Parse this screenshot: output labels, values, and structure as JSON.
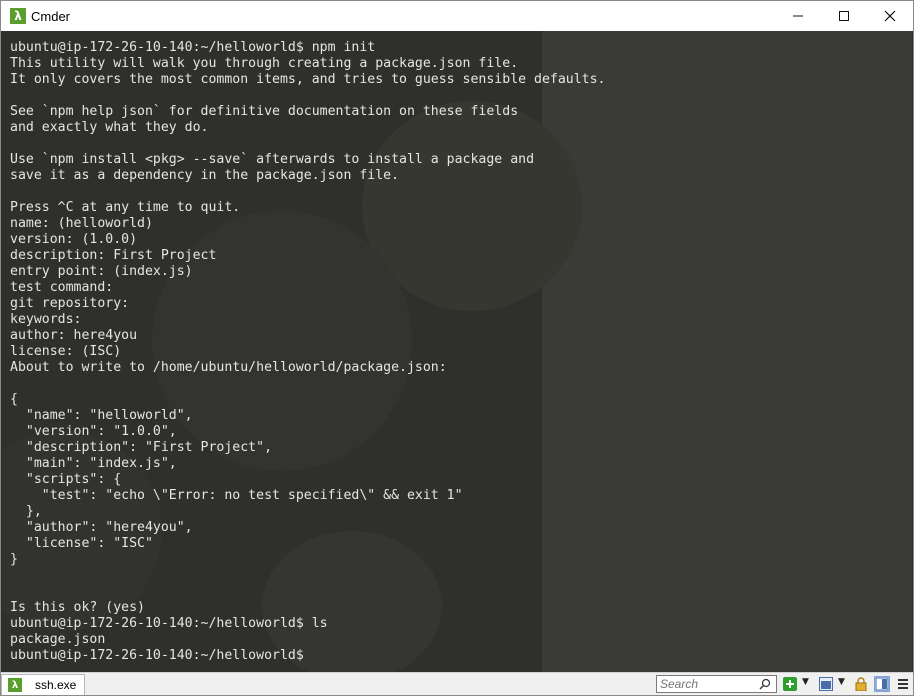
{
  "window": {
    "title": "Cmder",
    "app_icon_glyph": "λ",
    "controls": {
      "minimize": "—",
      "maximize": "☐",
      "close": "✕"
    }
  },
  "terminal": {
    "lines": [
      "ubuntu@ip-172-26-10-140:~/helloworld$ npm init",
      "This utility will walk you through creating a package.json file.",
      "It only covers the most common items, and tries to guess sensible defaults.",
      "",
      "See `npm help json` for definitive documentation on these fields",
      "and exactly what they do.",
      "",
      "Use `npm install <pkg> --save` afterwards to install a package and",
      "save it as a dependency in the package.json file.",
      "",
      "Press ^C at any time to quit.",
      "name: (helloworld)",
      "version: (1.0.0)",
      "description: First Project",
      "entry point: (index.js)",
      "test command:",
      "git repository:",
      "keywords:",
      "author: here4you",
      "license: (ISC)",
      "About to write to /home/ubuntu/helloworld/package.json:",
      "",
      "{",
      "  \"name\": \"helloworld\",",
      "  \"version\": \"1.0.0\",",
      "  \"description\": \"First Project\",",
      "  \"main\": \"index.js\",",
      "  \"scripts\": {",
      "    \"test\": \"echo \\\"Error: no test specified\\\" && exit 1\"",
      "  },",
      "  \"author\": \"here4you\",",
      "  \"license\": \"ISC\"",
      "}",
      "",
      "",
      "Is this ok? (yes)",
      "ubuntu@ip-172-26-10-140:~/helloworld$ ls",
      "package.json",
      "ubuntu@ip-172-26-10-140:~/helloworld$"
    ]
  },
  "statusbar": {
    "tab_label": "ssh.exe",
    "tab_icon_glyph": "λ",
    "search_placeholder": "Search"
  },
  "colors": {
    "terminal_bg": "#2f302b",
    "terminal_fg": "#e6e6e0",
    "accent": "#5a9e2e"
  },
  "icons": [
    "cmder-lambda-icon",
    "search-icon",
    "add-console-icon",
    "chevron-down-icon",
    "view-icon",
    "lock-icon",
    "split-view-icon",
    "menu-icon"
  ]
}
